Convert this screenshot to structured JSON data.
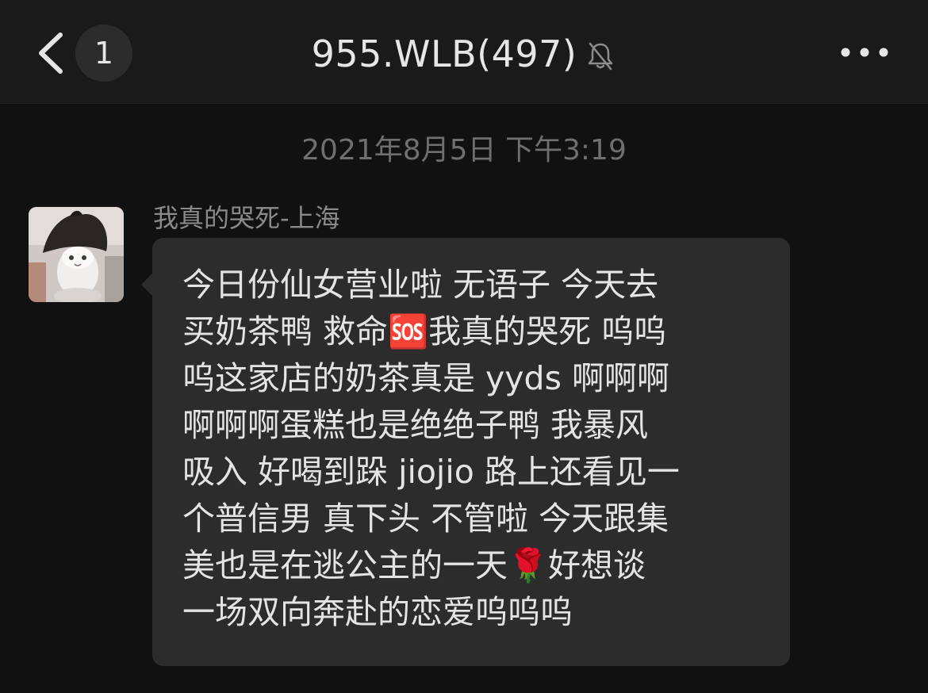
{
  "header": {
    "unread_count": "1",
    "title": "955.WLB(497)"
  },
  "timestamp": "2021年8月5日 下午3:19",
  "message": {
    "sender": "我真的哭死-上海",
    "lines": [
      "今日份仙女营业啦 无语子 今天去",
      "买奶茶鸭 救命🆘我真的哭死 呜呜",
      "呜这家店的奶茶真是 yyds 啊啊啊",
      "啊啊啊蛋糕也是绝绝子鸭 我暴风",
      "吸入 好喝到跺 jiojio 路上还看见一",
      "个普信男 真下头 不管啦 今天跟集",
      "美也是在逃公主的一天🌹好想谈",
      "一场双向奔赴的恋爱呜呜呜"
    ]
  }
}
